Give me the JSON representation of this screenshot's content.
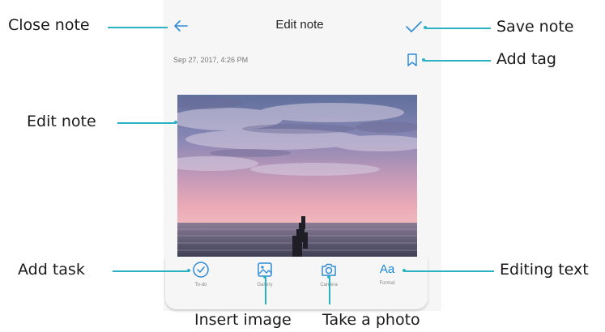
{
  "screen": {
    "title": "Edit note",
    "date": "Sep 27, 2017, 4:26 PM",
    "toolbar": [
      {
        "id": "todo",
        "label": "To-do",
        "icon": "check-circle-icon"
      },
      {
        "id": "gallery",
        "label": "Gallery",
        "icon": "image-icon"
      },
      {
        "id": "camera",
        "label": "Camera",
        "icon": "camera-icon"
      },
      {
        "id": "format",
        "label": "Format",
        "glyph": "Aa"
      }
    ]
  },
  "callouts": {
    "close_note": "Close note",
    "save_note": "Save note",
    "add_tag": "Add tag",
    "edit_note": "Edit note",
    "add_task": "Add task",
    "editing_text": "Editing text",
    "insert_image": "Insert image",
    "take_photo": "Take a photo"
  },
  "colors": {
    "accent": "#1a87d6",
    "leader": "#2ab2c4",
    "icon": "#2e8bd6"
  }
}
